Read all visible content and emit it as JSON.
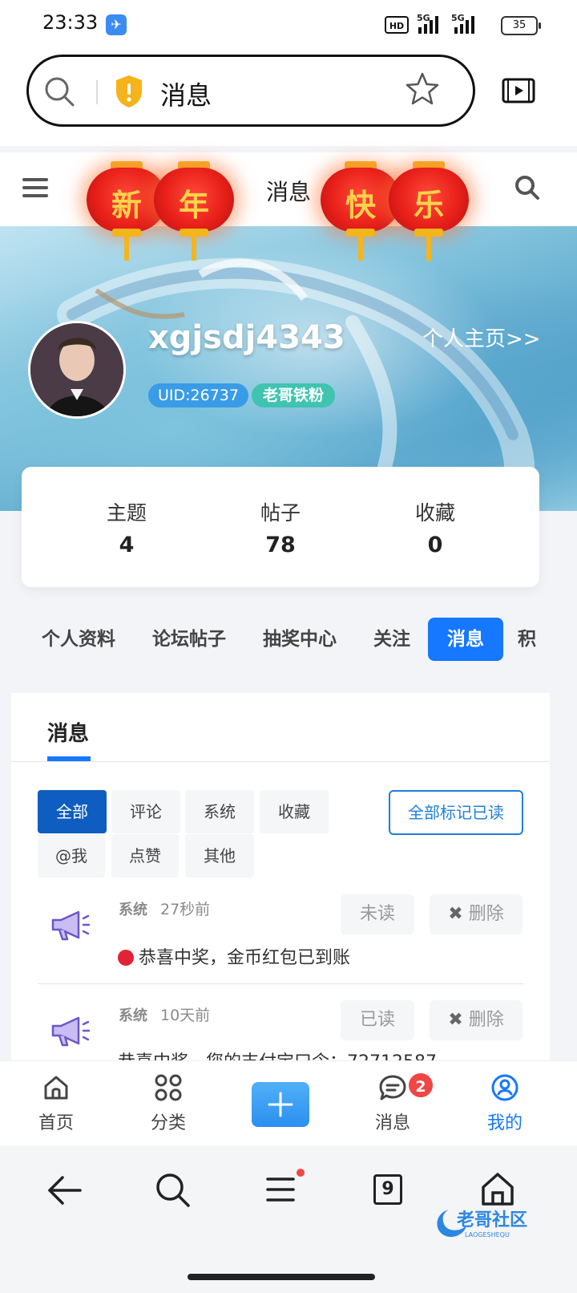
{
  "status_bar": {
    "time": "23:33",
    "signal_1": "5G",
    "signal_2": "5G",
    "hd": "HD",
    "battery": "35"
  },
  "browser": {
    "url_title": "消息",
    "icons": [
      "search-icon",
      "shield-warning-icon",
      "star-icon",
      "video-icon"
    ]
  },
  "site_header": {
    "title": "消息",
    "lanterns": [
      "新",
      "年",
      "快",
      "乐"
    ],
    "icons": [
      "menu-icon",
      "search-icon"
    ]
  },
  "profile": {
    "username": "xgjsdj4343",
    "homepage_link": "个人主页>>",
    "uid": "UID:26737",
    "fan_badge": "老哥铁粉"
  },
  "stats": [
    {
      "label": "主题",
      "value": "4"
    },
    {
      "label": "帖子",
      "value": "78"
    },
    {
      "label": "收藏",
      "value": "0"
    }
  ],
  "nav_tabs": [
    "个人资料",
    "论坛帖子",
    "抽奖中心",
    "关注",
    "消息",
    "积"
  ],
  "messages_panel": {
    "title": "消息",
    "filters": [
      "全部",
      "评论",
      "系统",
      "收藏",
      "@我",
      "点赞",
      "其他"
    ],
    "mark_all": "全部标记已读",
    "items": [
      {
        "type": "系统",
        "time": "27秒前",
        "status": "未读",
        "delete": "删除",
        "text": "恭喜中奖，金币红包已到账"
      },
      {
        "type": "系统",
        "time": "10天前",
        "status": "已读",
        "delete": "删除",
        "text": "恭喜中奖，您的支付宝口令：72712587"
      }
    ]
  },
  "app_nav": {
    "items": [
      "首页",
      "分类",
      "消息",
      "我的"
    ],
    "message_badge": "2"
  },
  "watermark": "老哥社区",
  "watermark_sub": "LAOGESHEQU",
  "tab_count": "9",
  "colors": {
    "accent": "#1677ff",
    "filter_active": "#0f5dc0",
    "badge_red": "#f04645",
    "uid_badge": "#3a9be6",
    "fan_badge": "#3fc4b0"
  }
}
